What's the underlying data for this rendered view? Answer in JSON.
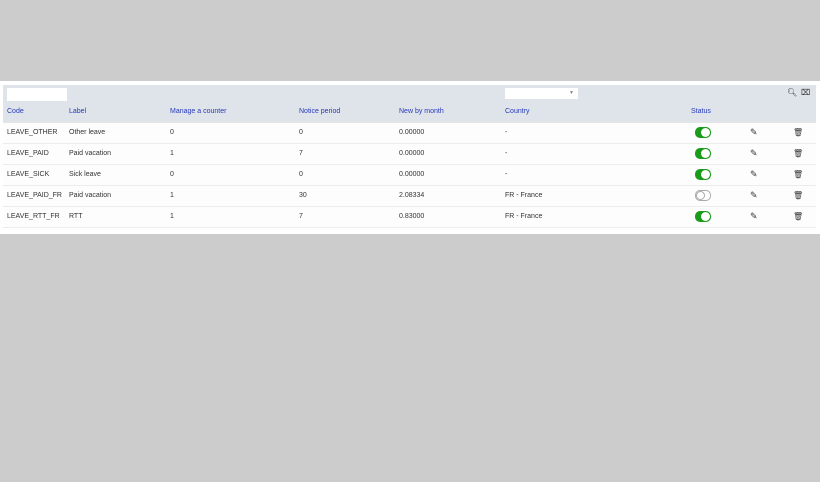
{
  "filters": {
    "search_icon": "search-icon",
    "clear_icon": "clear-filter-icon",
    "status_select": ""
  },
  "columns": [
    "Code",
    "Label",
    "Manage a counter",
    "Notice period",
    "New by month",
    "Country",
    "Status"
  ],
  "rows": [
    {
      "code": "LEAVE_OTHER",
      "label": "Other leave",
      "counter": "0",
      "notice": "0",
      "month": "0.00000",
      "country": "-",
      "status": true
    },
    {
      "code": "LEAVE_PAID",
      "label": "Paid vacation",
      "counter": "1",
      "notice": "7",
      "month": "0.00000",
      "country": "-",
      "status": true
    },
    {
      "code": "LEAVE_SICK",
      "label": "Sick leave",
      "counter": "0",
      "notice": "0",
      "month": "0.00000",
      "country": "-",
      "status": true
    },
    {
      "code": "LEAVE_PAID_FR",
      "label": "Paid vacation",
      "counter": "1",
      "notice": "30",
      "month": "2.08334",
      "country": "FR - France",
      "status": false
    },
    {
      "code": "LEAVE_RTT_FR",
      "label": "RTT",
      "counter": "1",
      "notice": "7",
      "month": "0.83000",
      "country": "FR - France",
      "status": true
    }
  ],
  "colors": {
    "header_text": "#2739b8",
    "toggle_on": "#1a9c1a",
    "header_bg": "#dfe4ea"
  }
}
